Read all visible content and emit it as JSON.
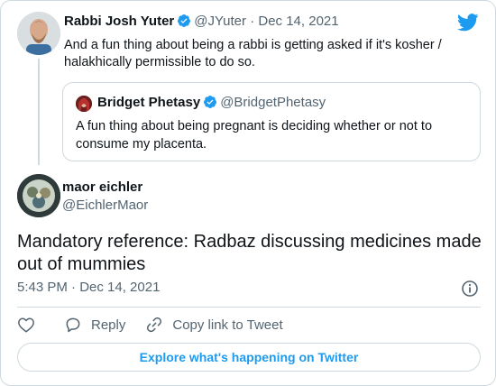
{
  "quoting_tweet": {
    "author_name": "Rabbi Josh Yuter",
    "author_handle": "@JYuter",
    "separator": "·",
    "date": "Dec 14, 2021",
    "text": "And a fun thing about being a rabbi is getting asked if it's kosher / halakhically permissible to do so."
  },
  "quoted_tweet": {
    "author_name": "Bridget Phetasy",
    "author_handle": "@BridgetPhetasy",
    "text": "A fun thing about being pregnant is deciding whether or not to consume my placenta."
  },
  "reply_tweet": {
    "author_name": "maor eichler",
    "author_handle": "@EichlerMaor",
    "text": "Mandatory reference: Radbaz discussing medicines made out of mummies",
    "timestamp": "5:43 PM · Dec 14, 2021"
  },
  "actions": {
    "reply_label": "Reply",
    "copy_link_label": "Copy link to Tweet"
  },
  "explore_label": "Explore what's happening on Twitter",
  "icons": {
    "brand": "twitter-bird-icon",
    "verified": "verified-badge-icon",
    "like": "heart-icon",
    "reply": "reply-bubble-icon",
    "share": "link-icon",
    "info": "info-icon"
  },
  "colors": {
    "accent": "#1d9bf0",
    "muted": "#536471",
    "border": "#cfd9de",
    "text": "#0f1419"
  }
}
